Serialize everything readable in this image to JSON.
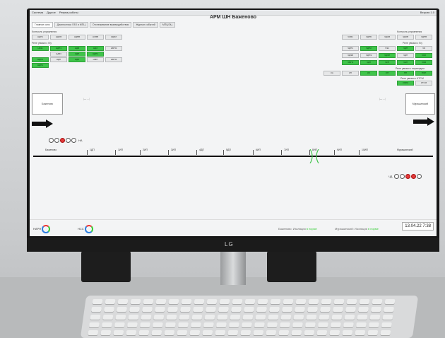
{
  "app": {
    "title": "АРМ ШН  Баженово"
  },
  "menu": [
    "Система",
    "Другое",
    "Режим работы"
  ],
  "menu_right": "Версия 1.0",
  "tabs": [
    "Главное окно",
    "Диагностика УЗО и МПЦ",
    "Отслеживание взаимодействия",
    "Журнал событий",
    "МПЦ/ЭЦ"
  ],
  "left_panel": {
    "label1": "Контроль управления",
    "row1": [
      "НДП1",
      "НДОВ",
      "НДВВ",
      "НСВВ",
      "ЗДКМ"
    ],
    "label2": "Реле увязки с б/у",
    "row2": [
      "НЗ11",
      "НДП1",
      "НДФ",
      "НДЗ",
      "НМП2"
    ],
    "row3": [
      "НДЗ3",
      "НДП",
      "НДП1"
    ],
    "row4": [
      "НДП2",
      "НДП",
      "НДЗ",
      "НМП",
      "НМП2"
    ],
    "row5": [
      "НДП1"
    ]
  },
  "right_panel": {
    "label1": "Контроль управления",
    "row1": [
      "ЧКМ1",
      "ЧДПБ",
      "ЧДНВ",
      "ЧДОВ",
      "ЧДПВ"
    ],
    "label2": "Реле увязки с б/у",
    "row2": [
      "ЧДП1",
      "ЧДП2",
      "ЧЭ1",
      "ЧДП",
      "ЧЭ"
    ],
    "row3": [
      "ЧДЭИ",
      "ЧДПЭ",
      "ЧДЭП",
      "ЧДП",
      "ЧЭО"
    ],
    "row4": [
      "ЧМП1",
      "ЧДП",
      "ЧКП",
      "ЧНП",
      "ЧЭФ"
    ],
    "label3": "Реле увязки с переездом",
    "row5": [
      "КА",
      "КП",
      "КО",
      "ОП",
      "ПП",
      "ПЭП"
    ],
    "label4": "Реле увязки с КТСМ",
    "row6": [
      "КЗКМ",
      "КТСМ"
    ]
  },
  "stations": {
    "left": "Баженово",
    "right": "Мурашинский"
  },
  "track_labels": [
    "Баженово",
    "1ДП",
    "1ИП",
    "2ИП",
    "3ИП",
    "4ДП",
    "5ДП",
    "6ИП",
    "7ИП",
    "8ИП",
    "9ИП",
    "10ИП",
    "Мурашинский"
  ],
  "signals": {
    "left_name": "НА",
    "right_name": "ЧД"
  },
  "status": {
    "left1": "НАРН",
    "left2": "НСС",
    "station1": "Баженово: Изоляция",
    "station1_state": "в норме",
    "station2": "Мурашинский: Изоляция",
    "station2_state": "в норме",
    "clock": "13.04.22 7:38"
  },
  "colors": {
    "active": "#3fc44a",
    "track": "#111111",
    "signal_red": "#e23b3b"
  }
}
